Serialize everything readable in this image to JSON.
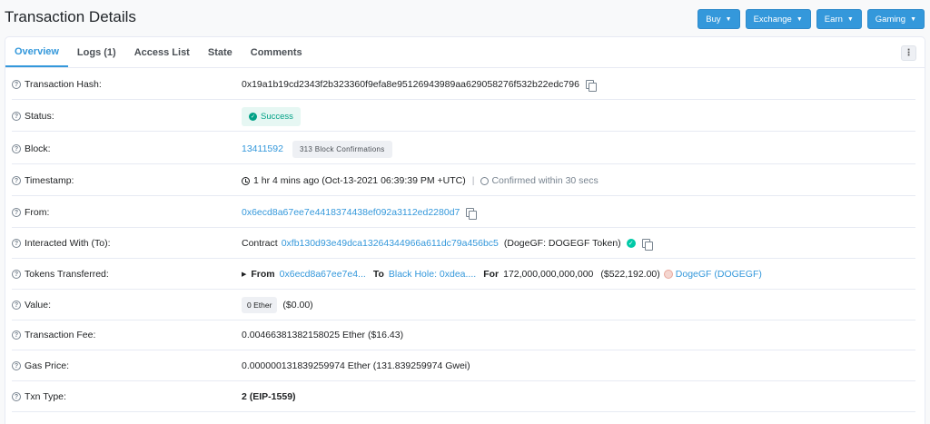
{
  "page": {
    "title": "Transaction Details"
  },
  "top_buttons": [
    {
      "label": "Buy"
    },
    {
      "label": "Exchange"
    },
    {
      "label": "Earn"
    },
    {
      "label": "Gaming"
    }
  ],
  "tabs": [
    {
      "label": "Overview",
      "active": true
    },
    {
      "label": "Logs (1)"
    },
    {
      "label": "Access List"
    },
    {
      "label": "State"
    },
    {
      "label": "Comments"
    }
  ],
  "rows": {
    "hash": {
      "label": "Transaction Hash:",
      "value": "0x19a1b19cd2343f2b323360f9efa8e95126943989aa629058276f532b22edc796"
    },
    "status": {
      "label": "Status:",
      "value": "Success"
    },
    "block": {
      "label": "Block:",
      "value": "13411592",
      "confirmations": "313 Block Confirmations"
    },
    "timestamp": {
      "label": "Timestamp:",
      "value": "1 hr 4 mins ago (Oct-13-2021 06:39:39 PM +UTC)",
      "confirmed": "Confirmed within 30 secs"
    },
    "from": {
      "label": "From:",
      "value": "0x6ecd8a67ee7e4418374438ef092a3112ed2280d7"
    },
    "interacted": {
      "label": "Interacted With (To):",
      "prefix": "Contract",
      "address": "0xfb130d93e49dca13264344966a611dc79a456bc5",
      "name": "(DogeGF: DOGEGF Token)"
    },
    "tokens": {
      "label": "Tokens Transferred:",
      "from_label": "From",
      "from_value": "0x6ecd8a67ee7e4...",
      "to_label": "To",
      "to_value": "Black Hole: 0xdea....",
      "for_label": "For",
      "amount": "172,000,000,000,000",
      "usd": "($522,192.00)",
      "token": "DogeGF (DOGEGF)"
    },
    "value": {
      "label": "Value:",
      "badge": "0 Ether",
      "usd": "($0.00)"
    },
    "fee": {
      "label": "Transaction Fee:",
      "value": "0.00466381382158025 Ether ($16.43)"
    },
    "gas": {
      "label": "Gas Price:",
      "value": "0.000000131839259974 Ether (131.839259974 Gwei)"
    },
    "txn_type": {
      "label": "Txn Type:",
      "value": "2 (EIP-1559)"
    }
  },
  "colors": {
    "accent": "#3498db",
    "success": "#00a186"
  }
}
